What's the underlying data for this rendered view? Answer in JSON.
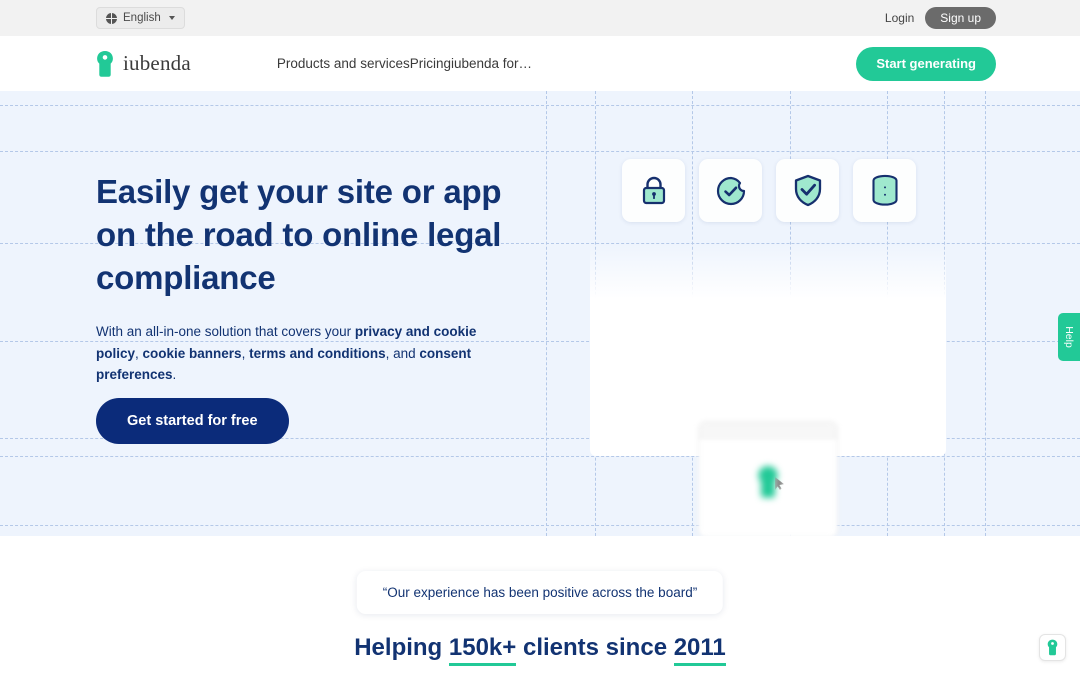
{
  "topbar": {
    "language": "English",
    "globe_icon": "globe-icon",
    "caret_icon": "chevron-down-icon",
    "login": "Login",
    "signup": "Sign up"
  },
  "nav": {
    "brand": "iubenda",
    "logo_icon": "iubenda-keyhole-logo",
    "links": [
      {
        "label": "Products and services"
      },
      {
        "label": "Pricing"
      },
      {
        "label": "iubenda for…"
      }
    ],
    "cta": "Start generating"
  },
  "hero": {
    "title": "Easily get your site or app on the road to online legal compliance",
    "subtitle": {
      "lead": "With an all-in-one solution that covers your ",
      "b1": "privacy and cookie policy",
      "sep1": ", ",
      "b2": "cookie banners",
      "sep2": ", ",
      "b3": "terms and conditions",
      "sep3": ", and ",
      "b4": "consent preferences",
      "end": "."
    },
    "cta": "Get started for free",
    "icon_cards": [
      {
        "icon": "padlock-icon"
      },
      {
        "icon": "cookie-check-icon"
      },
      {
        "icon": "shield-check-icon"
      },
      {
        "icon": "database-icon"
      }
    ]
  },
  "social_proof": {
    "quote": "“Our experience has been positive across the board”",
    "stats_prefix": "Helping ",
    "stats_count": "150k+",
    "stats_middle": " clients since ",
    "stats_year": "2011"
  },
  "widgets": {
    "help": "Help",
    "badge_icon": "iubenda-badge-logo"
  },
  "colors": {
    "green": "#22c997",
    "navy": "#123372",
    "navy_button": "#0b2b7a",
    "hero_bg": "#eef4fd",
    "topbar_bg": "#f2f2f2",
    "mint": "#9fe8ce",
    "signup_gray": "#6b6b6b"
  }
}
